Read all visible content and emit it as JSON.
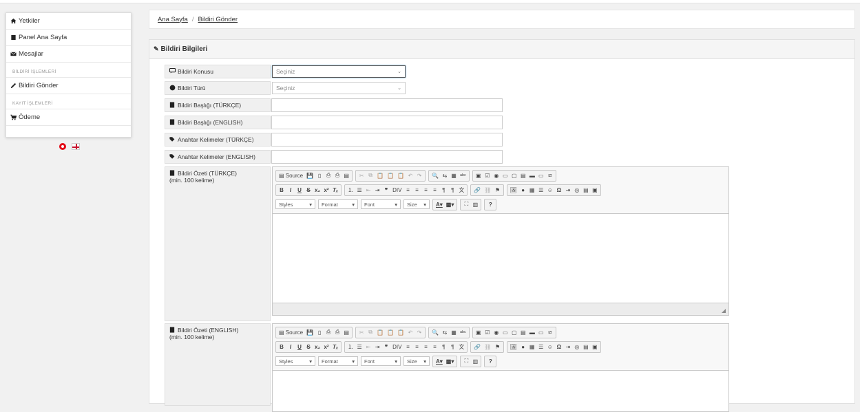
{
  "sidebar": {
    "items": [
      {
        "label": "Yetkiler",
        "icon": "home-icon"
      },
      {
        "label": "Panel Ana Sayfa",
        "icon": "book-icon"
      },
      {
        "label": "Mesajlar",
        "icon": "envelope-icon"
      }
    ],
    "section1": "BİLDİRİ İŞLEMLERİ",
    "item_submit": "Bildiri Gönder",
    "section2": "KAYIT İŞLEMLERİ",
    "item_payment": "Ödeme"
  },
  "breadcrumb": {
    "home": "Ana Sayfa",
    "separator": "/",
    "current": "Bildiri Gönder"
  },
  "panel": {
    "title": "Bildiri Bilgileri",
    "fields": {
      "subject_label": "Bildiri Konusu",
      "subject_value": "Seçiniz",
      "type_label": "Bildiri Türü",
      "type_value": "Seçiniz",
      "title_tr_label": "Bildiri Başlığı (TÜRKÇE)",
      "title_en_label": "Bildiri Başlığı (ENGLISH)",
      "keywords_tr_label": "Anahtar Kelimeler (TÜRKÇE)",
      "keywords_en_label": "Anahtar Kelimeler (ENGLISH)",
      "abstract_tr_label": "Bildiri Özeti (TÜRKÇE)",
      "abstract_tr_note": "(min. 100 kelime)",
      "abstract_en_label": "Bildiri Özeti (ENGLISH)",
      "abstract_en_note": "(min. 100 kelime)"
    }
  },
  "editor": {
    "source": "Source",
    "styles": "Styles",
    "format": "Format",
    "font": "Font",
    "size": "Size",
    "help": "?"
  },
  "colors": {
    "accent": "#337ab7",
    "flag_tr": "#e30a17"
  }
}
